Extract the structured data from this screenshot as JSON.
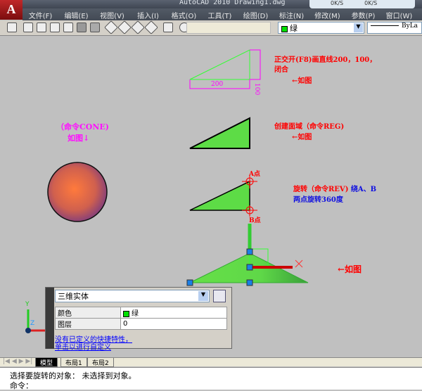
{
  "app": {
    "title": "AutoCAD 2010  Drawing1.dwg",
    "logo": "A",
    "net_down": "0K/S",
    "net_up": "0K/S"
  },
  "menu": [
    "文件(F)",
    "编辑(E)",
    "视图(V)",
    "插入(I)",
    "格式(O)",
    "工具(T)",
    "绘图(D)",
    "标注(N)",
    "修改(M)",
    "参数(P)",
    "窗口(W)"
  ],
  "toolbar": {
    "color_value": "绿",
    "linetype_value": "ByLa"
  },
  "drawing": {
    "step1": {
      "dim_h": "200",
      "dim_v": "100",
      "line1": "正交开(F8)画直线200，100，",
      "line2": "闭合",
      "arrow": "←如图"
    },
    "step2": {
      "line1": "创建面域（命令REG)",
      "arrow": "←如图"
    },
    "cone": {
      "line1": "（命令CONE)",
      "line2": "如图↓"
    },
    "step3": {
      "label_a": "A点",
      "label_b": "B点",
      "line1_red": "旋转（命令REV)",
      "line1_blue": " 绕A、B",
      "line2": "两点旋转360度",
      "arrow": "←如图"
    },
    "ucs": {
      "y": "Y",
      "z": "Z"
    }
  },
  "properties": {
    "type": "三维实体",
    "rows": [
      {
        "key": "颜色",
        "value": "绿"
      },
      {
        "key": "图层",
        "value": "0"
      }
    ],
    "link1": "没有已定义的快捷特性，",
    "link2": "单击以进行自定义"
  },
  "tabs": [
    "模型",
    "布局1",
    "布局2"
  ],
  "command": {
    "line1": "选择要旋转的对象：  未选择到对象。",
    "line2": "命令："
  },
  "colors": {
    "green": "#5ddc46",
    "red": "#ff0000",
    "magenta": "#ff00ff",
    "canvas": "#c0c0c0"
  }
}
